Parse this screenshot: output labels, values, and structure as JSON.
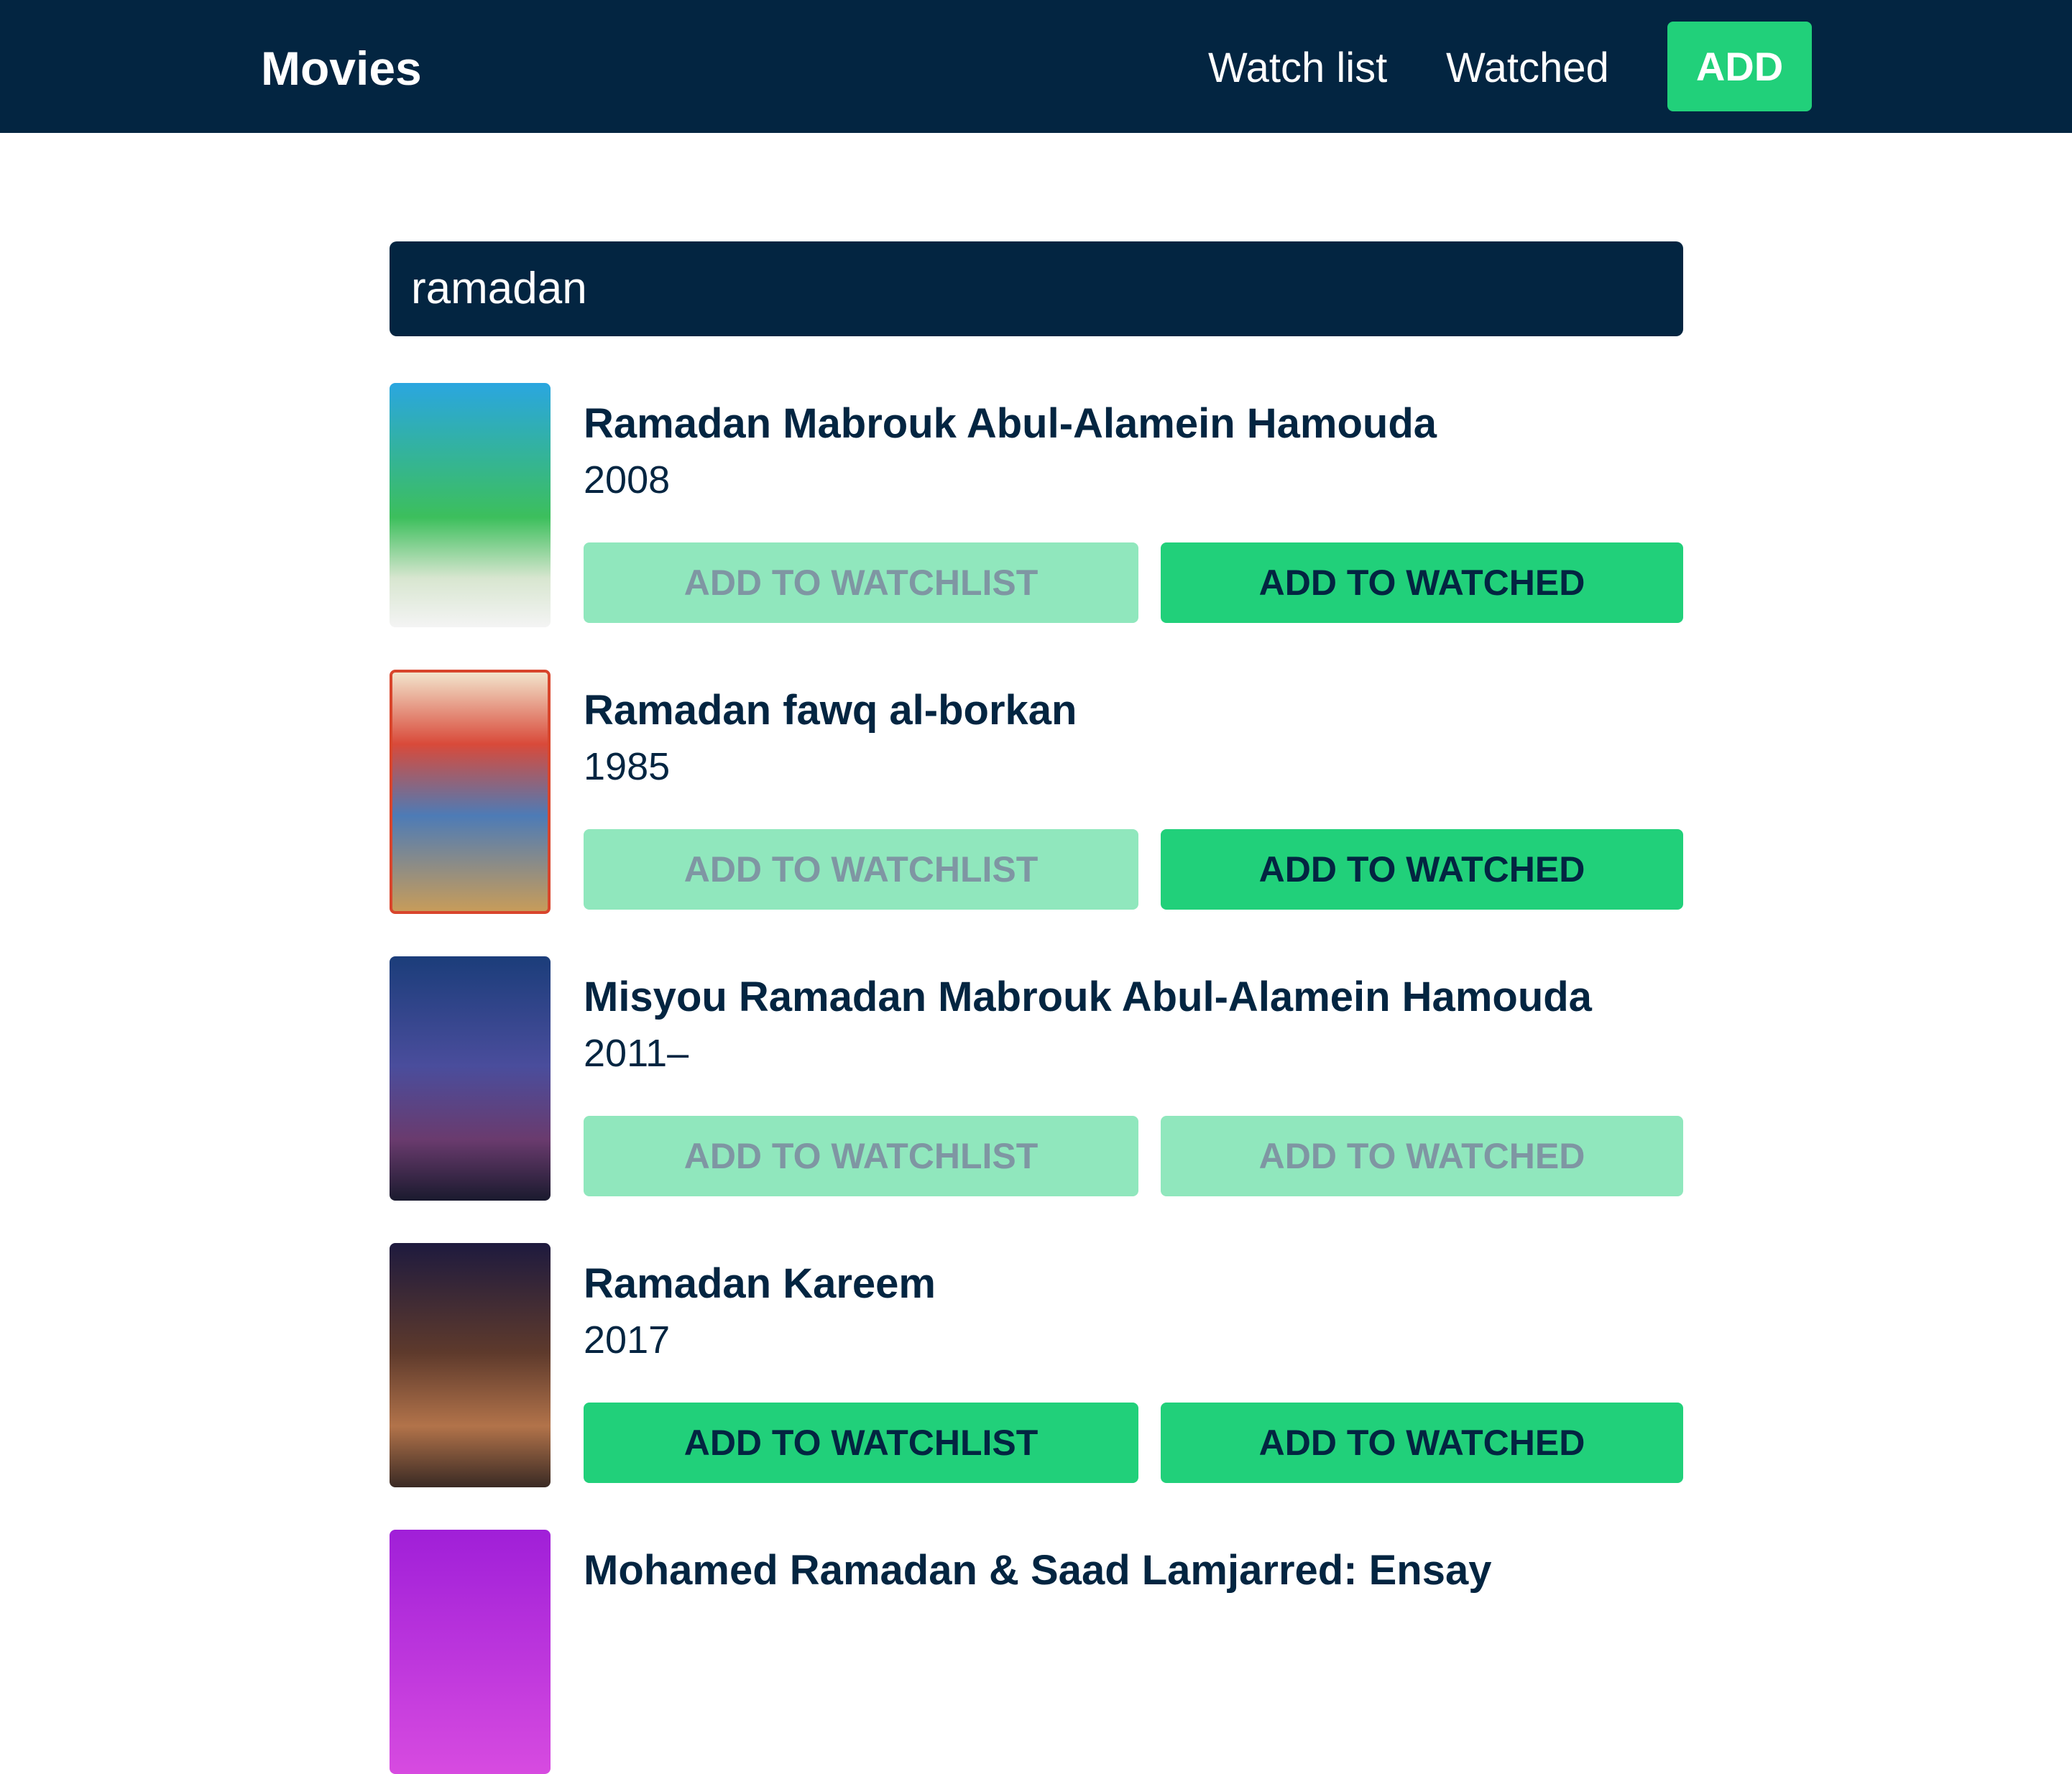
{
  "navbar": {
    "brand": "Movies",
    "links": [
      "Watch list",
      "Watched"
    ],
    "add_label": "ADD"
  },
  "search": {
    "value": "ramadan"
  },
  "results": [
    {
      "title": "Ramadan Mabrouk Abul-Alamein Hamouda",
      "year": "2008",
      "watchlist_label": "ADD TO WATCHLIST",
      "watched_label": "ADD TO WATCHED",
      "watchlist_enabled": false,
      "watched_enabled": true
    },
    {
      "title": "Ramadan fawq al-borkan",
      "year": "1985",
      "watchlist_label": "ADD TO WATCHLIST",
      "watched_label": "ADD TO WATCHED",
      "watchlist_enabled": false,
      "watched_enabled": true
    },
    {
      "title": "Misyou Ramadan Mabrouk Abul-Alamein Hamouda",
      "year": "2011–",
      "watchlist_label": "ADD TO WATCHLIST",
      "watched_label": "ADD TO WATCHED",
      "watchlist_enabled": false,
      "watched_enabled": false
    },
    {
      "title": "Ramadan Kareem",
      "year": "2017",
      "watchlist_label": "ADD TO WATCHLIST",
      "watched_label": "ADD TO WATCHED",
      "watchlist_enabled": true,
      "watched_enabled": true
    },
    {
      "title": "Mohamed Ramadan & Saad Lamjarred: Ensay"
    }
  ],
  "colors": {
    "navy": "#032541",
    "green": "#21d07a",
    "green_disabled": "#90e7bd"
  }
}
